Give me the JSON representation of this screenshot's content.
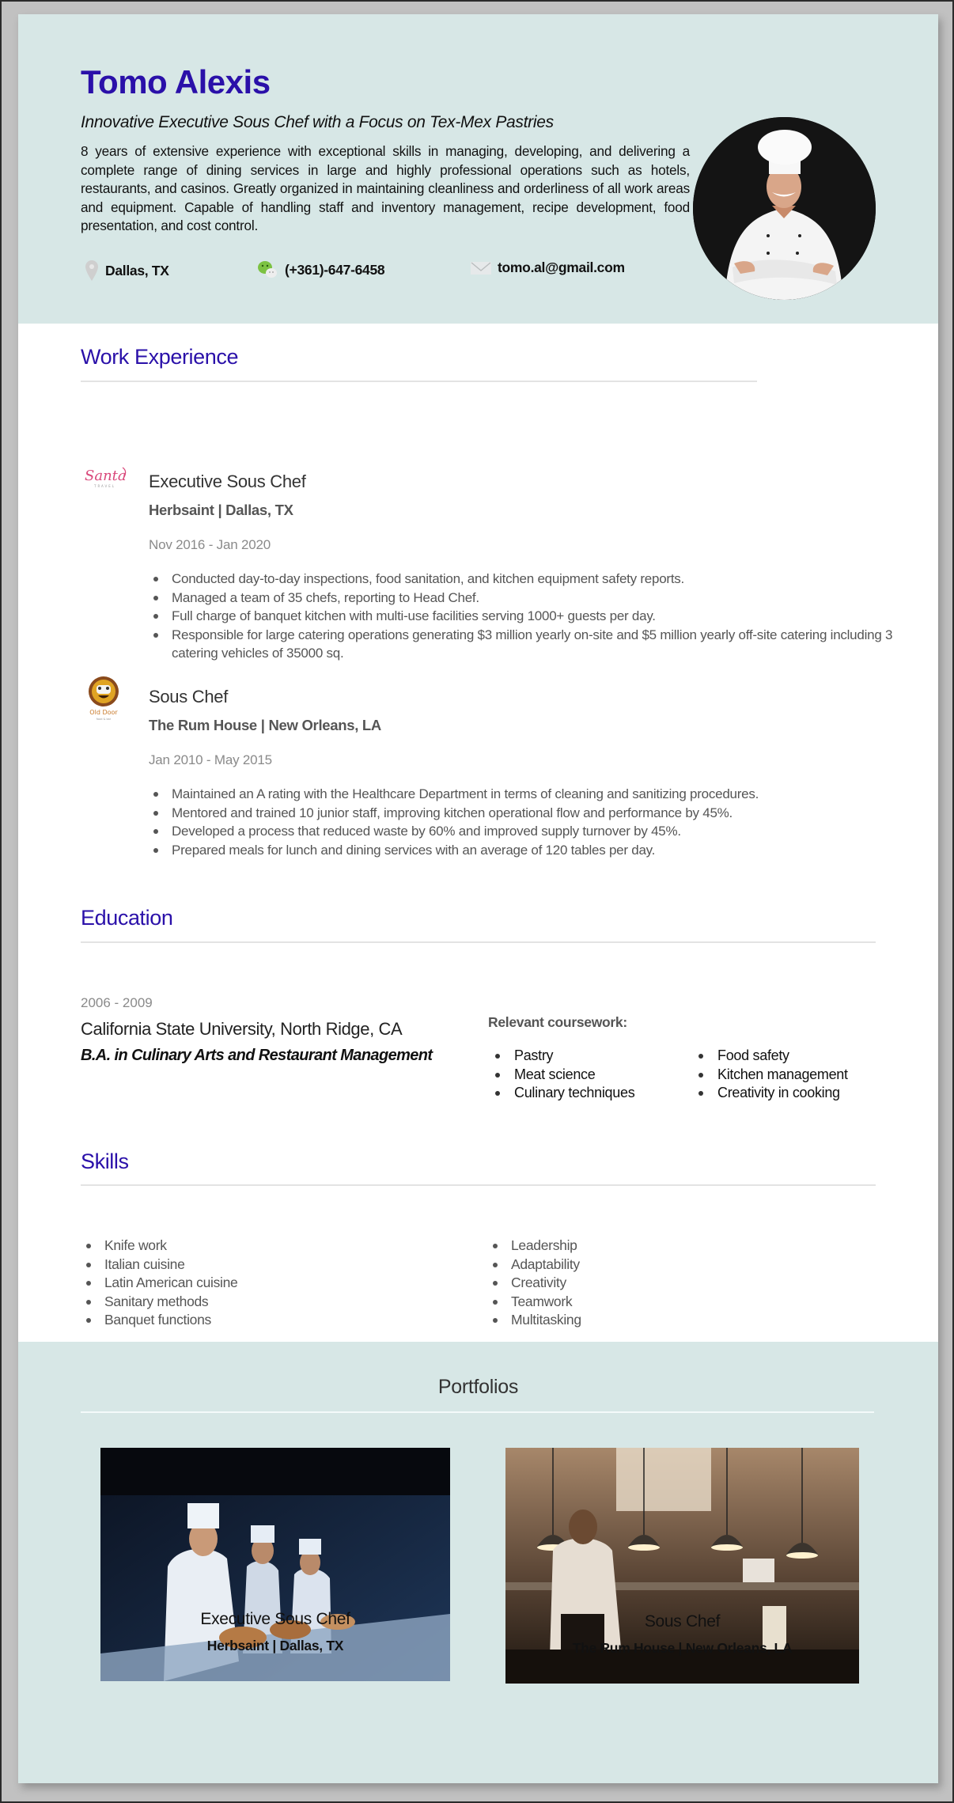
{
  "header": {
    "name": "Tomo Alexis",
    "tagline": "Innovative Executive Sous Chef with a Focus on Tex-Mex Pastries",
    "summary": "8 years of extensive experience with exceptional skills in managing, developing, and delivering a complete range of dining services in large and highly professional operations such as hotels, restaurants, and casinos. Greatly organized in maintaining cleanliness and orderliness of all work areas and equipment. Capable of handling staff and inventory management, recipe development, food presentation, and cost control.",
    "contact": {
      "location": "Dallas, TX",
      "location_icon": "map-pin-icon",
      "phone": "(+361)-647-6458",
      "phone_icon": "wechat-icon",
      "email": "tomo.al@gmail.com",
      "email_icon": "envelope-icon"
    },
    "photo_alt": "Chef portrait with crossed arms"
  },
  "work_experience": {
    "title": "Work Experience",
    "jobs": [
      {
        "logo": "Santa",
        "logo_sub": "TRAVEL",
        "title": "Executive Sous Chef",
        "company": "Herbsaint | Dallas, TX",
        "dates": "Nov 2016 - Jan 2020",
        "bullets": [
          "Conducted day-to-day inspections, food sanitation, and kitchen equipment safety reports.",
          "Managed a team of 35 chefs, reporting to Head Chef.",
          "Full charge of banquet kitchen with multi-use facilities serving 1000+ guests per day.",
          "Responsible for large catering operations generating $3 million yearly on-site and $5 million yearly off-site catering including 3 catering vehicles of 35000 sq."
        ]
      },
      {
        "logo": "Old Door",
        "logo_sub": "food & bar",
        "title": "Sous Chef",
        "company": "The Rum House | New Orleans, LA",
        "dates": "Jan 2010 - May 2015",
        "bullets": [
          "Maintained an A rating with the Healthcare Department in terms of cleaning and sanitizing procedures.",
          "Mentored and trained 10 junior staff, improving kitchen operational flow and performance by 45%.",
          "Developed a process that reduced waste by 60% and improved supply turnover by 45%.",
          "Prepared meals for lunch and dining services with an average of 120 tables per day."
        ]
      }
    ]
  },
  "education": {
    "title": "Education",
    "dates": "2006 - 2009",
    "school": "California State University, North Ridge, CA",
    "degree": "B.A. in Culinary Arts and Restaurant Management",
    "coursework_label": "Relevant coursework:",
    "coursework_col1": [
      "Pastry",
      "Meat science",
      "Culinary techniques"
    ],
    "coursework_col2": [
      "Food safety",
      "Kitchen management",
      "Creativity in cooking"
    ]
  },
  "skills": {
    "title": "Skills",
    "col1": [
      "Knife work",
      "Italian cuisine",
      "Latin American cuisine",
      "Sanitary methods",
      "Banquet functions"
    ],
    "col2": [
      "Leadership",
      "Adaptability",
      "Creativity",
      "Teamwork",
      "Multitasking"
    ]
  },
  "portfolios": {
    "title": "Portfolios",
    "items": [
      {
        "title": "Executive Sous Chef",
        "subtitle": "Herbsaint | Dallas, TX",
        "image_alt": "Chefs preparing pastries at a counter"
      },
      {
        "title": "Sous Chef",
        "subtitle": "The Rum House | New Orleans, LA",
        "image_alt": "Chef in a restaurant kitchen under pendant lamps"
      }
    ]
  },
  "colors": {
    "accent": "#2a10a9",
    "band_background": "#d7e7e6",
    "body_text": "#555555",
    "muted_text": "#8a8a8a"
  }
}
